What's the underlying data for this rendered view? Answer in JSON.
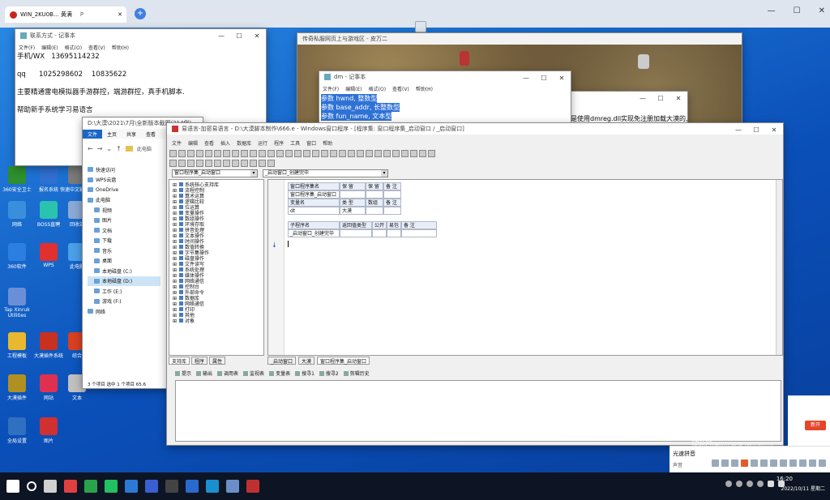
{
  "browser": {
    "tab_title": "WIN_2KU0B... 黄满",
    "tab_extra": "P",
    "new_tab": "+"
  },
  "desktop_icons": [
    {
      "label": "360安全卫士",
      "color": "#2d8f2d"
    },
    {
      "label": "报名系统",
      "color": "#2f6fd0"
    },
    {
      "label": "快速中文输入法",
      "color": "#7a7a7a"
    },
    {
      "label": "网络",
      "color": "#3a8fdc"
    },
    {
      "label": "BOSS直聘",
      "color": "#2ac3b0"
    },
    {
      "label": "回收站",
      "color": "#8aa9d6"
    },
    {
      "label": "360软件",
      "color": "#2b7fe0"
    },
    {
      "label": "WPS",
      "color": "#e03030"
    },
    {
      "label": "此电脑",
      "color": "#4aa0e8"
    },
    {
      "label": "Tap Xinruk Utilities",
      "color": "#6a8fd8"
    },
    {
      "label": "工程模板",
      "color": "#e8b830"
    },
    {
      "label": "大漠插件系统",
      "color": "#c83020"
    },
    {
      "label": "综合",
      "color": "#d84020"
    },
    {
      "label": "大漠插件",
      "color": "#b09020"
    },
    {
      "label": "网站",
      "color": "#e03050"
    },
    {
      "label": "文本",
      "color": "#c0c0c0"
    },
    {
      "label": "全局设置",
      "color": "#3070c0"
    },
    {
      "label": "图片",
      "color": "#d03030"
    }
  ],
  "notepad1": {
    "title": "联系方式 - 记事本",
    "menu": [
      "文件(F)",
      "编辑(E)",
      "格式(O)",
      "查看(V)",
      "帮助(H)"
    ],
    "lines": [
      "手机/WX   13695114232",
      "",
      "qq      1025298602    10835622",
      "",
      "主要精通雷电模拟器手游群控，端游群控，真手机脚本.",
      "",
      "帮助新手系统学习易语言"
    ]
  },
  "explorer": {
    "title": "D:\\大漠\\2021\\7月\\全新版本截图(214例)",
    "ribbon": [
      "文件",
      "主页",
      "共享",
      "查看"
    ],
    "address": "此电脑",
    "nav": [
      "快速访问",
      "WPS云盘",
      "OneDrive",
      "此电脑",
      "视频",
      "图片",
      "文档",
      "下载",
      "音乐",
      "桌面",
      "本地磁盘 (C:)",
      "本地磁盘 (D:)",
      "工作 (E:)",
      "游戏 (F:)",
      "网络"
    ],
    "status": "3 个项目     选中 1 个项目  65.6"
  },
  "game": {
    "title": "传奇私服网页上与游戏区 - 皮万二"
  },
  "notepad2": {
    "title": "dm - 记事本",
    "menu": [
      "文件(F)",
      "编辑(E)",
      "格式(O)",
      "查看(V)",
      "帮助(H)"
    ],
    "lines": [
      "参数 hwnd, 整数型",
      "参数 base_addr, 长整数型",
      "参数 fun_name, 文本型"
    ]
  },
  "side_note": "是使用dmreg.dll实现免注册加载大漠的,这个",
  "ide": {
    "title": "易语言-加密易语言 - D:\\大漠脚本制作\\666.e - Windows窗口程序 - [程序集: 窗口程序集_启动窗口 / _启动窗口]",
    "menu": [
      "文件",
      "编辑",
      "查看",
      "插入",
      "数据库",
      "运行",
      "程序",
      "工具",
      "窗口",
      "帮助"
    ],
    "combo_left": "窗口程序集_启动窗口",
    "combo_right": "_启动窗口_创建完毕",
    "tree": [
      "系统核心支持库",
      "流程控制",
      "算术运算",
      "逻辑比较",
      "位运算",
      "变量操作",
      "数组操作",
      "环境存取",
      "拼音处理",
      "文本操作",
      "时间操作",
      "数值转换",
      "字节集操作",
      "磁盘操作",
      "文件读写",
      "系统处理",
      "媒体操作",
      "网络通信",
      "控制台",
      "外部命令",
      "数据库",
      "网络通信",
      "打印",
      "其他",
      "对象"
    ],
    "tree_tabs": [
      "支持库",
      "程序",
      "属性"
    ],
    "table1": {
      "headers": [
        "窗口程序集名",
        "保 留",
        "保 留",
        "备 注"
      ],
      "row": [
        "窗口程序集_启动窗口",
        "",
        "",
        ""
      ]
    },
    "table2": {
      "headers": [
        "变量名",
        "类 型",
        "数组",
        "备 注"
      ],
      "row": [
        "dt",
        "大漠",
        "",
        ""
      ]
    },
    "table3": {
      "headers": [
        "子程序名",
        "返回值类型",
        "公开",
        "易包",
        "备 注"
      ],
      "row": [
        "_启动窗口_创建完毕",
        "",
        "",
        "",
        ""
      ]
    },
    "doc_tabs": [
      "_启动窗口",
      "大漠",
      "窗口程序集_启动窗口"
    ],
    "bottom_tabs": [
      "提示",
      "输出",
      "调用表",
      "监视表",
      "变量表",
      "搜寻1",
      "搜寻2",
      "剪辑历史"
    ]
  },
  "activation": {
    "line1": "激活 Windows",
    "line2": "转到\"设置\"以激活 Windows。"
  },
  "ad": {
    "button": "新开"
  },
  "ime": {
    "label": "光速拼音",
    "sublabel": "声音"
  },
  "taskbar": {
    "time": "16:20",
    "date": "2022/10/11 星期二"
  }
}
